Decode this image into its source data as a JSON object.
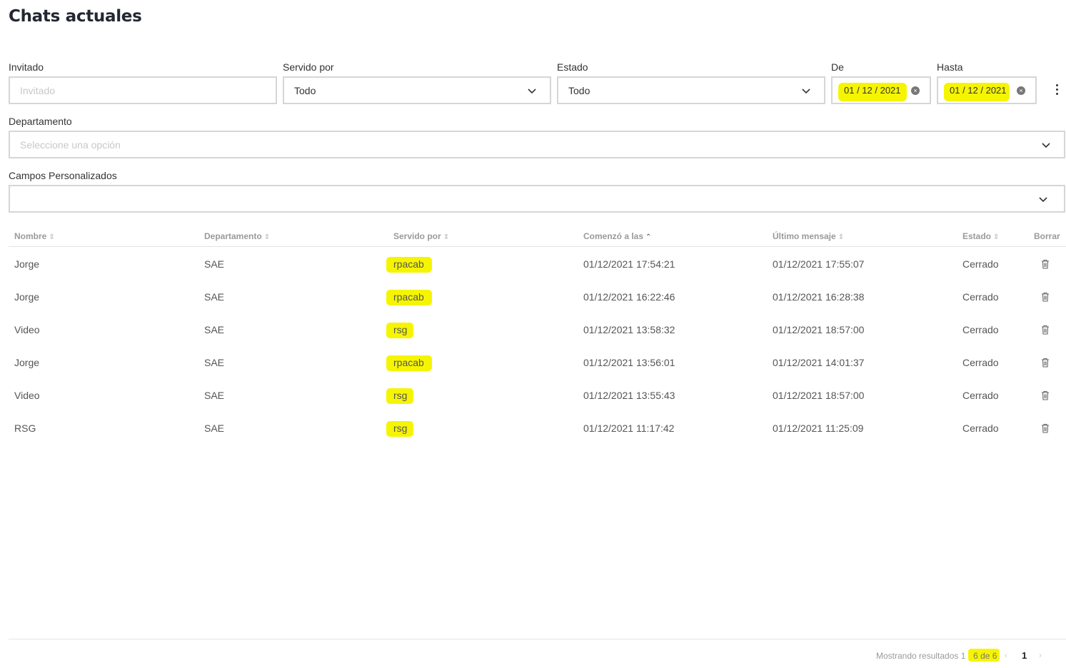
{
  "page_title": "Chats actuales",
  "filters": {
    "invitado": {
      "label": "Invitado",
      "placeholder": "Invitado"
    },
    "servido_por": {
      "label": "Servido por",
      "value": "Todo"
    },
    "estado": {
      "label": "Estado",
      "value": "Todo"
    },
    "de": {
      "label": "De",
      "value": "01 / 12 / 2021"
    },
    "hasta": {
      "label": "Hasta",
      "value": "01 / 12 / 2021"
    },
    "departamento": {
      "label": "Departamento",
      "placeholder": "Seleccione una opción"
    },
    "campos_personalizados": {
      "label": "Campos Personalizados",
      "value": ""
    }
  },
  "table": {
    "headers": {
      "nombre": "Nombre",
      "departamento": "Departamento",
      "servido_por": "Servido por",
      "comenzo": "Comenzó a las",
      "ultimo": "Último mensaje",
      "estado": "Estado",
      "borrar": "Borrar"
    },
    "rows": [
      {
        "nombre": "Jorge",
        "departamento": "SAE",
        "servido_por": "rpacab",
        "comenzo": "01/12/2021 17:54:21",
        "ultimo": "01/12/2021 17:55:07",
        "estado": "Cerrado"
      },
      {
        "nombre": "Jorge",
        "departamento": "SAE",
        "servido_por": "rpacab",
        "comenzo": "01/12/2021 16:22:46",
        "ultimo": "01/12/2021 16:28:38",
        "estado": "Cerrado"
      },
      {
        "nombre": "Video",
        "departamento": "SAE",
        "servido_por": "rsg",
        "comenzo": "01/12/2021 13:58:32",
        "ultimo": "01/12/2021 18:57:00",
        "estado": "Cerrado"
      },
      {
        "nombre": "Jorge",
        "departamento": "SAE",
        "servido_por": "rpacab",
        "comenzo": "01/12/2021 13:56:01",
        "ultimo": "01/12/2021 14:01:37",
        "estado": "Cerrado"
      },
      {
        "nombre": "Video",
        "departamento": "SAE",
        "servido_por": "rsg",
        "comenzo": "01/12/2021 13:55:43",
        "ultimo": "01/12/2021 18:57:00",
        "estado": "Cerrado"
      },
      {
        "nombre": "RSG",
        "departamento": "SAE",
        "servido_por": "rsg",
        "comenzo": "01/12/2021 11:17:42",
        "ultimo": "01/12/2021 11:25:09",
        "estado": "Cerrado"
      }
    ]
  },
  "pagination": {
    "results_prefix": "Mostrando resultados 1 - ",
    "results_range": "6 de 6",
    "prev": "‹",
    "current_page": "1",
    "next": "›"
  },
  "colors": {
    "highlight": "#f6f500",
    "border": "#d6d6d6",
    "header_text": "#9a9a9a"
  },
  "icons": [
    "chevron-down-icon",
    "clear-icon",
    "kebab-menu-icon",
    "sort-icon",
    "trash-icon"
  ]
}
